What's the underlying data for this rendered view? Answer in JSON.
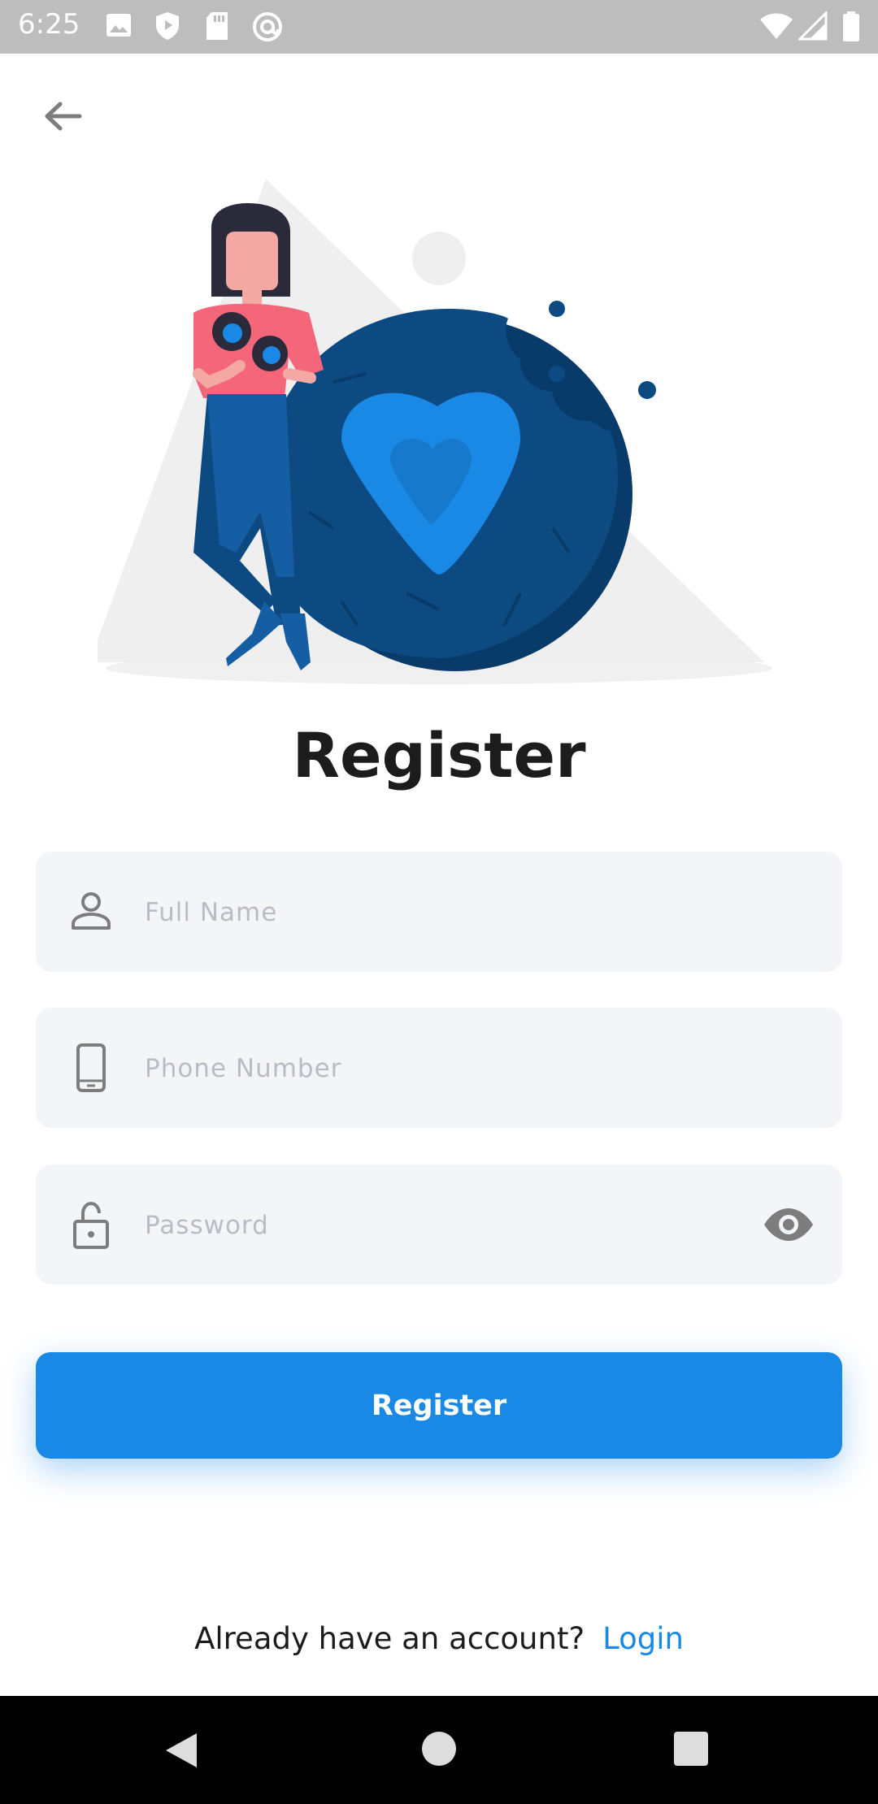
{
  "status_bar": {
    "time": "6:25",
    "left_icons": [
      "image-icon",
      "shield-icon",
      "sd-card-icon",
      "at-sign-icon"
    ],
    "right_icons": [
      "wifi-icon",
      "signal-icon",
      "battery-icon"
    ]
  },
  "header": {
    "back_icon": "arrow-left-icon"
  },
  "illustration": {
    "description_icon": "person-with-cookie-heart-illustration"
  },
  "title": "Register",
  "form": {
    "full_name": {
      "icon": "person-icon",
      "placeholder": "Full Name",
      "value": ""
    },
    "phone": {
      "icon": "phone-icon",
      "placeholder": "Phone Number",
      "value": ""
    },
    "password": {
      "icon": "lock-icon",
      "placeholder": "Password",
      "value": "",
      "toggle_icon": "eye-icon"
    }
  },
  "register_button": {
    "label": "Register"
  },
  "footer": {
    "prompt": "Already have an account?",
    "link": "Login"
  },
  "colors": {
    "accent": "#1a88e5",
    "field_bg": "#f4f5f9",
    "title": "#1c1c1c",
    "navy": "#0d4a82"
  }
}
